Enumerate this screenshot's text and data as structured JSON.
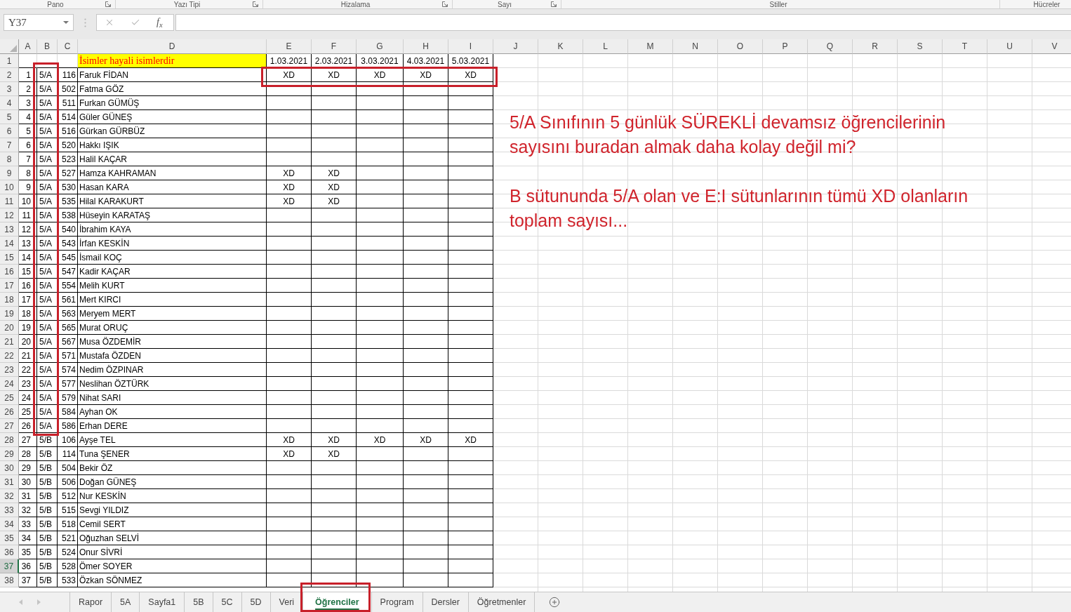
{
  "ribbon": {
    "groups": [
      {
        "label": "Pano",
        "launcher": true
      },
      {
        "label": "Yazı Tipi",
        "launcher": true
      },
      {
        "label": "Hizalama",
        "launcher": true
      },
      {
        "label": "Sayı",
        "launcher": true
      },
      {
        "label": "Stiller",
        "launcher": false
      },
      {
        "label": "Hücreler",
        "launcher": false
      }
    ]
  },
  "formula_bar": {
    "name_box": "Y37",
    "function_label": "f$_{x}$"
  },
  "sheet": {
    "columns": [
      "A",
      "B",
      "C",
      "D",
      "E",
      "F",
      "G",
      "H",
      "I",
      "J",
      "K",
      "L",
      "M",
      "N",
      "O",
      "P",
      "Q",
      "R",
      "S",
      "T",
      "U",
      "V"
    ],
    "rows": [
      {
        "number": "1",
        "selected": false,
        "kind": "title",
        "cells": {
          "d": "İsimler hayali isimlerdir",
          "e": "1.03.2021",
          "f": "2.03.2021",
          "g": "3.03.2021",
          "h": "4.03.2021",
          "i": "5.03.2021"
        }
      },
      {
        "number": "2",
        "selected": false,
        "kind": "data",
        "cells": {
          "a": "1",
          "b": "5/A",
          "c": "116",
          "d": "Faruk FİDAN",
          "e": "XD",
          "f": "XD",
          "g": "XD",
          "h": "XD",
          "i": "XD"
        }
      },
      {
        "number": "3",
        "selected": false,
        "kind": "data",
        "cells": {
          "a": "2",
          "b": "5/A",
          "c": "502",
          "d": "Fatma GÖZ"
        }
      },
      {
        "number": "4",
        "selected": false,
        "kind": "data",
        "cells": {
          "a": "3",
          "b": "5/A",
          "c": "511",
          "d": "Furkan GÜMÜŞ"
        }
      },
      {
        "number": "5",
        "selected": false,
        "kind": "data",
        "cells": {
          "a": "4",
          "b": "5/A",
          "c": "514",
          "d": "Güler GÜNEŞ"
        }
      },
      {
        "number": "6",
        "selected": false,
        "kind": "data",
        "cells": {
          "a": "5",
          "b": "5/A",
          "c": "516",
          "d": "Gürkan GÜRBÜZ"
        }
      },
      {
        "number": "7",
        "selected": false,
        "kind": "data",
        "cells": {
          "a": "6",
          "b": "5/A",
          "c": "520",
          "d": "Hakkı IŞIK"
        }
      },
      {
        "number": "8",
        "selected": false,
        "kind": "data",
        "cells": {
          "a": "7",
          "b": "5/A",
          "c": "523",
          "d": "Halil KAÇAR"
        }
      },
      {
        "number": "9",
        "selected": false,
        "kind": "data",
        "cells": {
          "a": "8",
          "b": "5/A",
          "c": "527",
          "d": "Hamza KAHRAMAN",
          "e": "XD",
          "f": "XD"
        }
      },
      {
        "number": "10",
        "selected": false,
        "kind": "data",
        "cells": {
          "a": "9",
          "b": "5/A",
          "c": "530",
          "d": "Hasan KARA",
          "e": "XD",
          "f": "XD"
        }
      },
      {
        "number": "11",
        "selected": false,
        "kind": "data",
        "cells": {
          "a": "10",
          "b": "5/A",
          "c": "535",
          "d": "Hilal KARAKURT",
          "e": "XD",
          "f": "XD"
        }
      },
      {
        "number": "12",
        "selected": false,
        "kind": "data",
        "cells": {
          "a": "11",
          "b": "5/A",
          "c": "538",
          "d": "Hüseyin KARATAŞ"
        }
      },
      {
        "number": "13",
        "selected": false,
        "kind": "data",
        "cells": {
          "a": "12",
          "b": "5/A",
          "c": "540",
          "d": "İbrahim KAYA"
        }
      },
      {
        "number": "14",
        "selected": false,
        "kind": "data",
        "cells": {
          "a": "13",
          "b": "5/A",
          "c": "543",
          "d": "İrfan KESKİN"
        }
      },
      {
        "number": "15",
        "selected": false,
        "kind": "data",
        "cells": {
          "a": "14",
          "b": "5/A",
          "c": "545",
          "d": "İsmail KOÇ"
        }
      },
      {
        "number": "16",
        "selected": false,
        "kind": "data",
        "cells": {
          "a": "15",
          "b": "5/A",
          "c": "547",
          "d": "Kadir KAÇAR"
        }
      },
      {
        "number": "17",
        "selected": false,
        "kind": "data",
        "cells": {
          "a": "16",
          "b": "5/A",
          "c": "554",
          "d": "Melih KURT"
        }
      },
      {
        "number": "18",
        "selected": false,
        "kind": "data",
        "cells": {
          "a": "17",
          "b": "5/A",
          "c": "561",
          "d": "Mert KIRCI"
        }
      },
      {
        "number": "19",
        "selected": false,
        "kind": "data",
        "cells": {
          "a": "18",
          "b": "5/A",
          "c": "563",
          "d": "Meryem MERT"
        }
      },
      {
        "number": "20",
        "selected": false,
        "kind": "data",
        "cells": {
          "a": "19",
          "b": "5/A",
          "c": "565",
          "d": "Murat ORUÇ"
        }
      },
      {
        "number": "21",
        "selected": false,
        "kind": "data",
        "cells": {
          "a": "20",
          "b": "5/A",
          "c": "567",
          "d": "Musa ÖZDEMİR"
        }
      },
      {
        "number": "22",
        "selected": false,
        "kind": "data",
        "cells": {
          "a": "21",
          "b": "5/A",
          "c": "571",
          "d": "Mustafa ÖZDEN"
        }
      },
      {
        "number": "23",
        "selected": false,
        "kind": "data",
        "cells": {
          "a": "22",
          "b": "5/A",
          "c": "574",
          "d": "Nedim ÖZPINAR"
        }
      },
      {
        "number": "24",
        "selected": false,
        "kind": "data",
        "cells": {
          "a": "23",
          "b": "5/A",
          "c": "577",
          "d": "Neslihan ÖZTÜRK"
        }
      },
      {
        "number": "25",
        "selected": false,
        "kind": "data",
        "cells": {
          "a": "24",
          "b": "5/A",
          "c": "579",
          "d": "Nihat SARI"
        }
      },
      {
        "number": "26",
        "selected": false,
        "kind": "data",
        "cells": {
          "a": "25",
          "b": "5/A",
          "c": "584",
          "d": "Ayhan OK"
        }
      },
      {
        "number": "27",
        "selected": false,
        "kind": "data",
        "cells": {
          "a": "26",
          "b": "5/A",
          "c": "586",
          "d": "Erhan DERE"
        }
      },
      {
        "number": "28",
        "selected": false,
        "kind": "data",
        "cells": {
          "a": "27",
          "b": "5/B",
          "c": "106",
          "d": "Ayşe TEL",
          "e": "XD",
          "f": "XD",
          "g": "XD",
          "h": "XD",
          "i": "XD"
        }
      },
      {
        "number": "29",
        "selected": false,
        "kind": "data",
        "cells": {
          "a": "28",
          "b": "5/B",
          "c": "114",
          "d": "Tuna ŞENER",
          "e": "XD",
          "f": "XD"
        }
      },
      {
        "number": "30",
        "selected": false,
        "kind": "data",
        "cells": {
          "a": "29",
          "b": "5/B",
          "c": "504",
          "d": "Bekir ÖZ"
        }
      },
      {
        "number": "31",
        "selected": false,
        "kind": "data",
        "cells": {
          "a": "30",
          "b": "5/B",
          "c": "506",
          "d": "Doğan GÜNEŞ"
        }
      },
      {
        "number": "32",
        "selected": false,
        "kind": "data",
        "cells": {
          "a": "31",
          "b": "5/B",
          "c": "512",
          "d": "Nur KESKİN"
        }
      },
      {
        "number": "33",
        "selected": false,
        "kind": "data",
        "cells": {
          "a": "32",
          "b": "5/B",
          "c": "515",
          "d": "Sevgi YILDIZ"
        }
      },
      {
        "number": "34",
        "selected": false,
        "kind": "data",
        "cells": {
          "a": "33",
          "b": "5/B",
          "c": "518",
          "d": "Cemil SERT"
        }
      },
      {
        "number": "35",
        "selected": false,
        "kind": "data",
        "cells": {
          "a": "34",
          "b": "5/B",
          "c": "521",
          "d": "Oğuzhan SELVİ"
        }
      },
      {
        "number": "36",
        "selected": false,
        "kind": "data",
        "cells": {
          "a": "35",
          "b": "5/B",
          "c": "524",
          "d": "Onur SİVRİ"
        }
      },
      {
        "number": "37",
        "selected": true,
        "kind": "data",
        "cells": {
          "a": "36",
          "b": "5/B",
          "c": "528",
          "d": "Ömer SOYER"
        }
      },
      {
        "number": "38",
        "selected": false,
        "kind": "data",
        "cells": {
          "a": "37",
          "b": "5/B",
          "c": "533",
          "d": "Özkan SÖNMEZ"
        }
      }
    ]
  },
  "annotation": {
    "paragraphs": [
      "5/A Sınıfının 5 günlük SÜREKLİ devamsız öğrencilerinin sayısını buradan almak daha kolay değil mi?",
      "B sütununda 5/A olan ve E:I sütunlarının tümü XD olanların toplam sayısı..."
    ]
  },
  "sheet_tabs": [
    {
      "label": "Rapor",
      "selected": false
    },
    {
      "label": "5A",
      "selected": false
    },
    {
      "label": "Sayfa1",
      "selected": false
    },
    {
      "label": "5B",
      "selected": false
    },
    {
      "label": "5C",
      "selected": false
    },
    {
      "label": "5D",
      "selected": false
    },
    {
      "label": "Veri",
      "selected": false
    },
    {
      "label": "Öğrenciler",
      "selected": true
    },
    {
      "label": "Program",
      "selected": false
    },
    {
      "label": "Dersler",
      "selected": false
    },
    {
      "label": "Öğretmenler",
      "selected": false
    }
  ]
}
